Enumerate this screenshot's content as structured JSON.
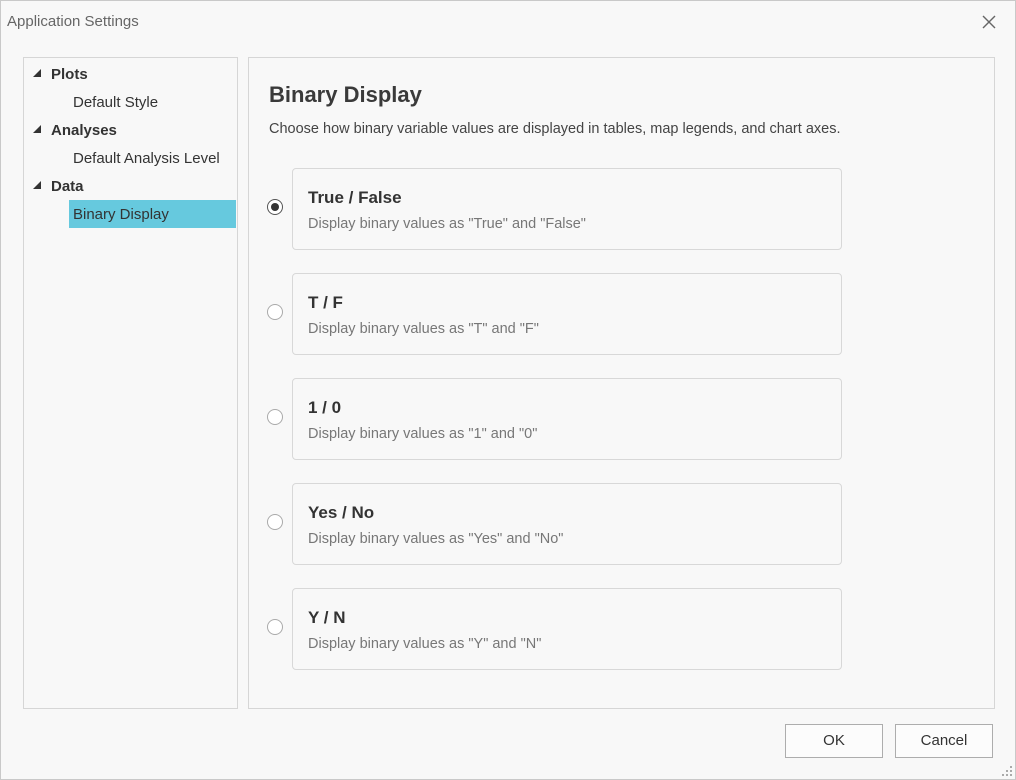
{
  "window": {
    "title": "Application Settings"
  },
  "tree": {
    "groups": [
      {
        "label": "Plots",
        "items": [
          {
            "label": "Default Style"
          }
        ]
      },
      {
        "label": "Analyses",
        "items": [
          {
            "label": "Default Analysis Level"
          }
        ]
      },
      {
        "label": "Data",
        "items": [
          {
            "label": "Binary Display",
            "selected": true
          }
        ]
      }
    ]
  },
  "content": {
    "heading": "Binary Display",
    "description": "Choose how binary variable values are displayed in tables, map legends, and chart axes.",
    "options": [
      {
        "title": "True / False",
        "description": "Display binary values as \"True\" and \"False\"",
        "checked": true
      },
      {
        "title": "T / F",
        "description": "Display binary values as \"T\" and \"F\"",
        "checked": false
      },
      {
        "title": "1 / 0",
        "description": "Display binary values as \"1\" and \"0\"",
        "checked": false
      },
      {
        "title": "Yes / No",
        "description": "Display binary values as \"Yes\" and \"No\"",
        "checked": false
      },
      {
        "title": "Y / N",
        "description": "Display binary values as \"Y\" and \"N\"",
        "checked": false
      }
    ]
  },
  "footer": {
    "ok_label": "OK",
    "cancel_label": "Cancel"
  },
  "colors": {
    "selection": "#66c9de",
    "border": "#d6d6d6",
    "background": "#f8f8f8"
  },
  "icons": {
    "close": "close-icon",
    "expand": "caret-expanded-icon",
    "resize": "resize-grip-icon"
  }
}
